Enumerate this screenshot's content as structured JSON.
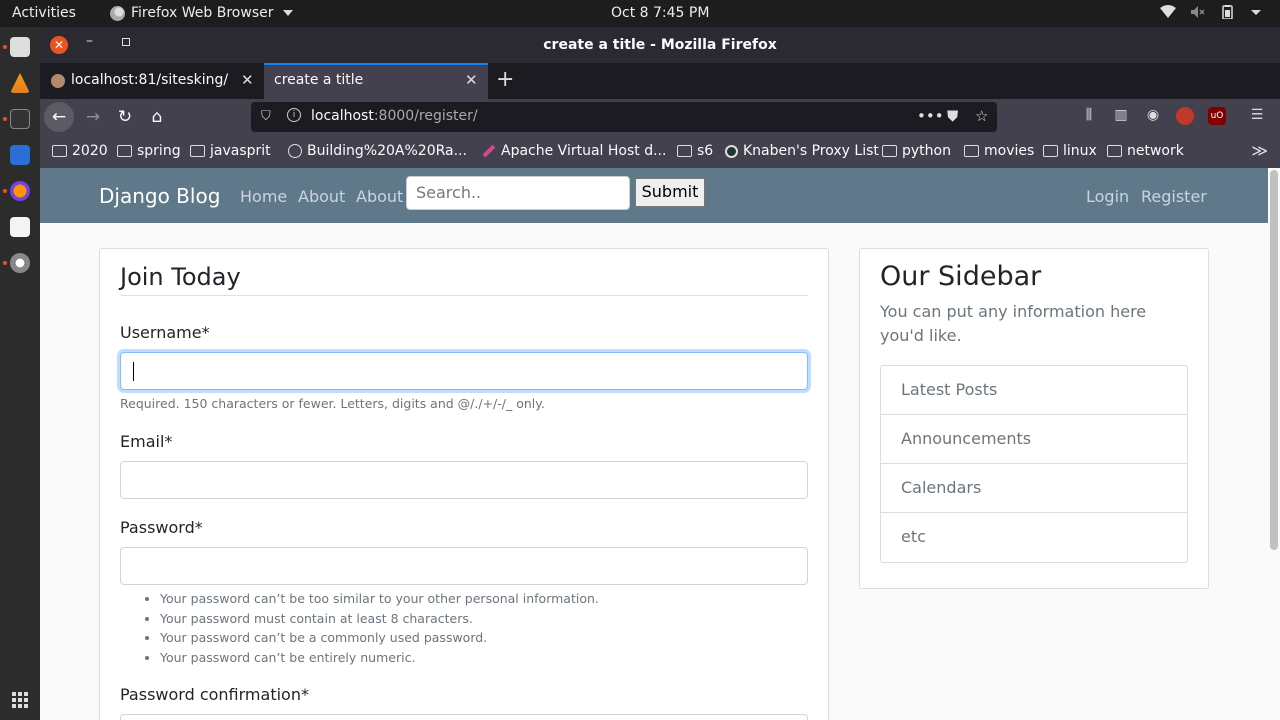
{
  "system": {
    "activities": "Activities",
    "app_name": "Firefox Web Browser",
    "clock": "Oct 8  7:45 PM"
  },
  "window": {
    "title": "create a title - Mozilla Firefox"
  },
  "tabs": [
    {
      "label": "localhost:81/sitesking/"
    },
    {
      "label": "create a title"
    }
  ],
  "urlbar": {
    "host": "localhost",
    "rest": ":8000/register/"
  },
  "bookmarks": [
    {
      "label": "2020",
      "icon": "folder"
    },
    {
      "label": "spring",
      "icon": "folder"
    },
    {
      "label": "javasprit",
      "icon": "folder"
    },
    {
      "label": "Building%20A%20Ra...",
      "icon": "globe"
    },
    {
      "label": "Apache Virtual Host d...",
      "icon": "pen"
    },
    {
      "label": "s6",
      "icon": "folder"
    },
    {
      "label": "Knaben's Proxy List",
      "icon": "eye"
    },
    {
      "label": "python",
      "icon": "folder"
    },
    {
      "label": "movies",
      "icon": "folder"
    },
    {
      "label": "linux",
      "icon": "folder"
    },
    {
      "label": "network",
      "icon": "folder"
    }
  ],
  "site_nav": {
    "brand": "Django Blog",
    "links": [
      "Home",
      "About",
      "About"
    ],
    "search_placeholder": "Search..",
    "submit": "Submit",
    "right_links": [
      "Login",
      "Register"
    ]
  },
  "form": {
    "legend": "Join Today",
    "username_label": "Username*",
    "username_help": "Required. 150 characters or fewer. Letters, digits and @/./+/-/_ only.",
    "email_label": "Email*",
    "password_label": "Password*",
    "password_hints": [
      "Your password can’t be too similar to your other personal information.",
      "Your password must contain at least 8 characters.",
      "Your password can’t be a commonly used password.",
      "Your password can’t be entirely numeric."
    ],
    "password_confirm_label": "Password confirmation*"
  },
  "sidebar": {
    "title": "Our Sidebar",
    "description": "You can put any information here you'd like.",
    "items": [
      "Latest Posts",
      "Announcements",
      "Calendars",
      "etc"
    ]
  }
}
